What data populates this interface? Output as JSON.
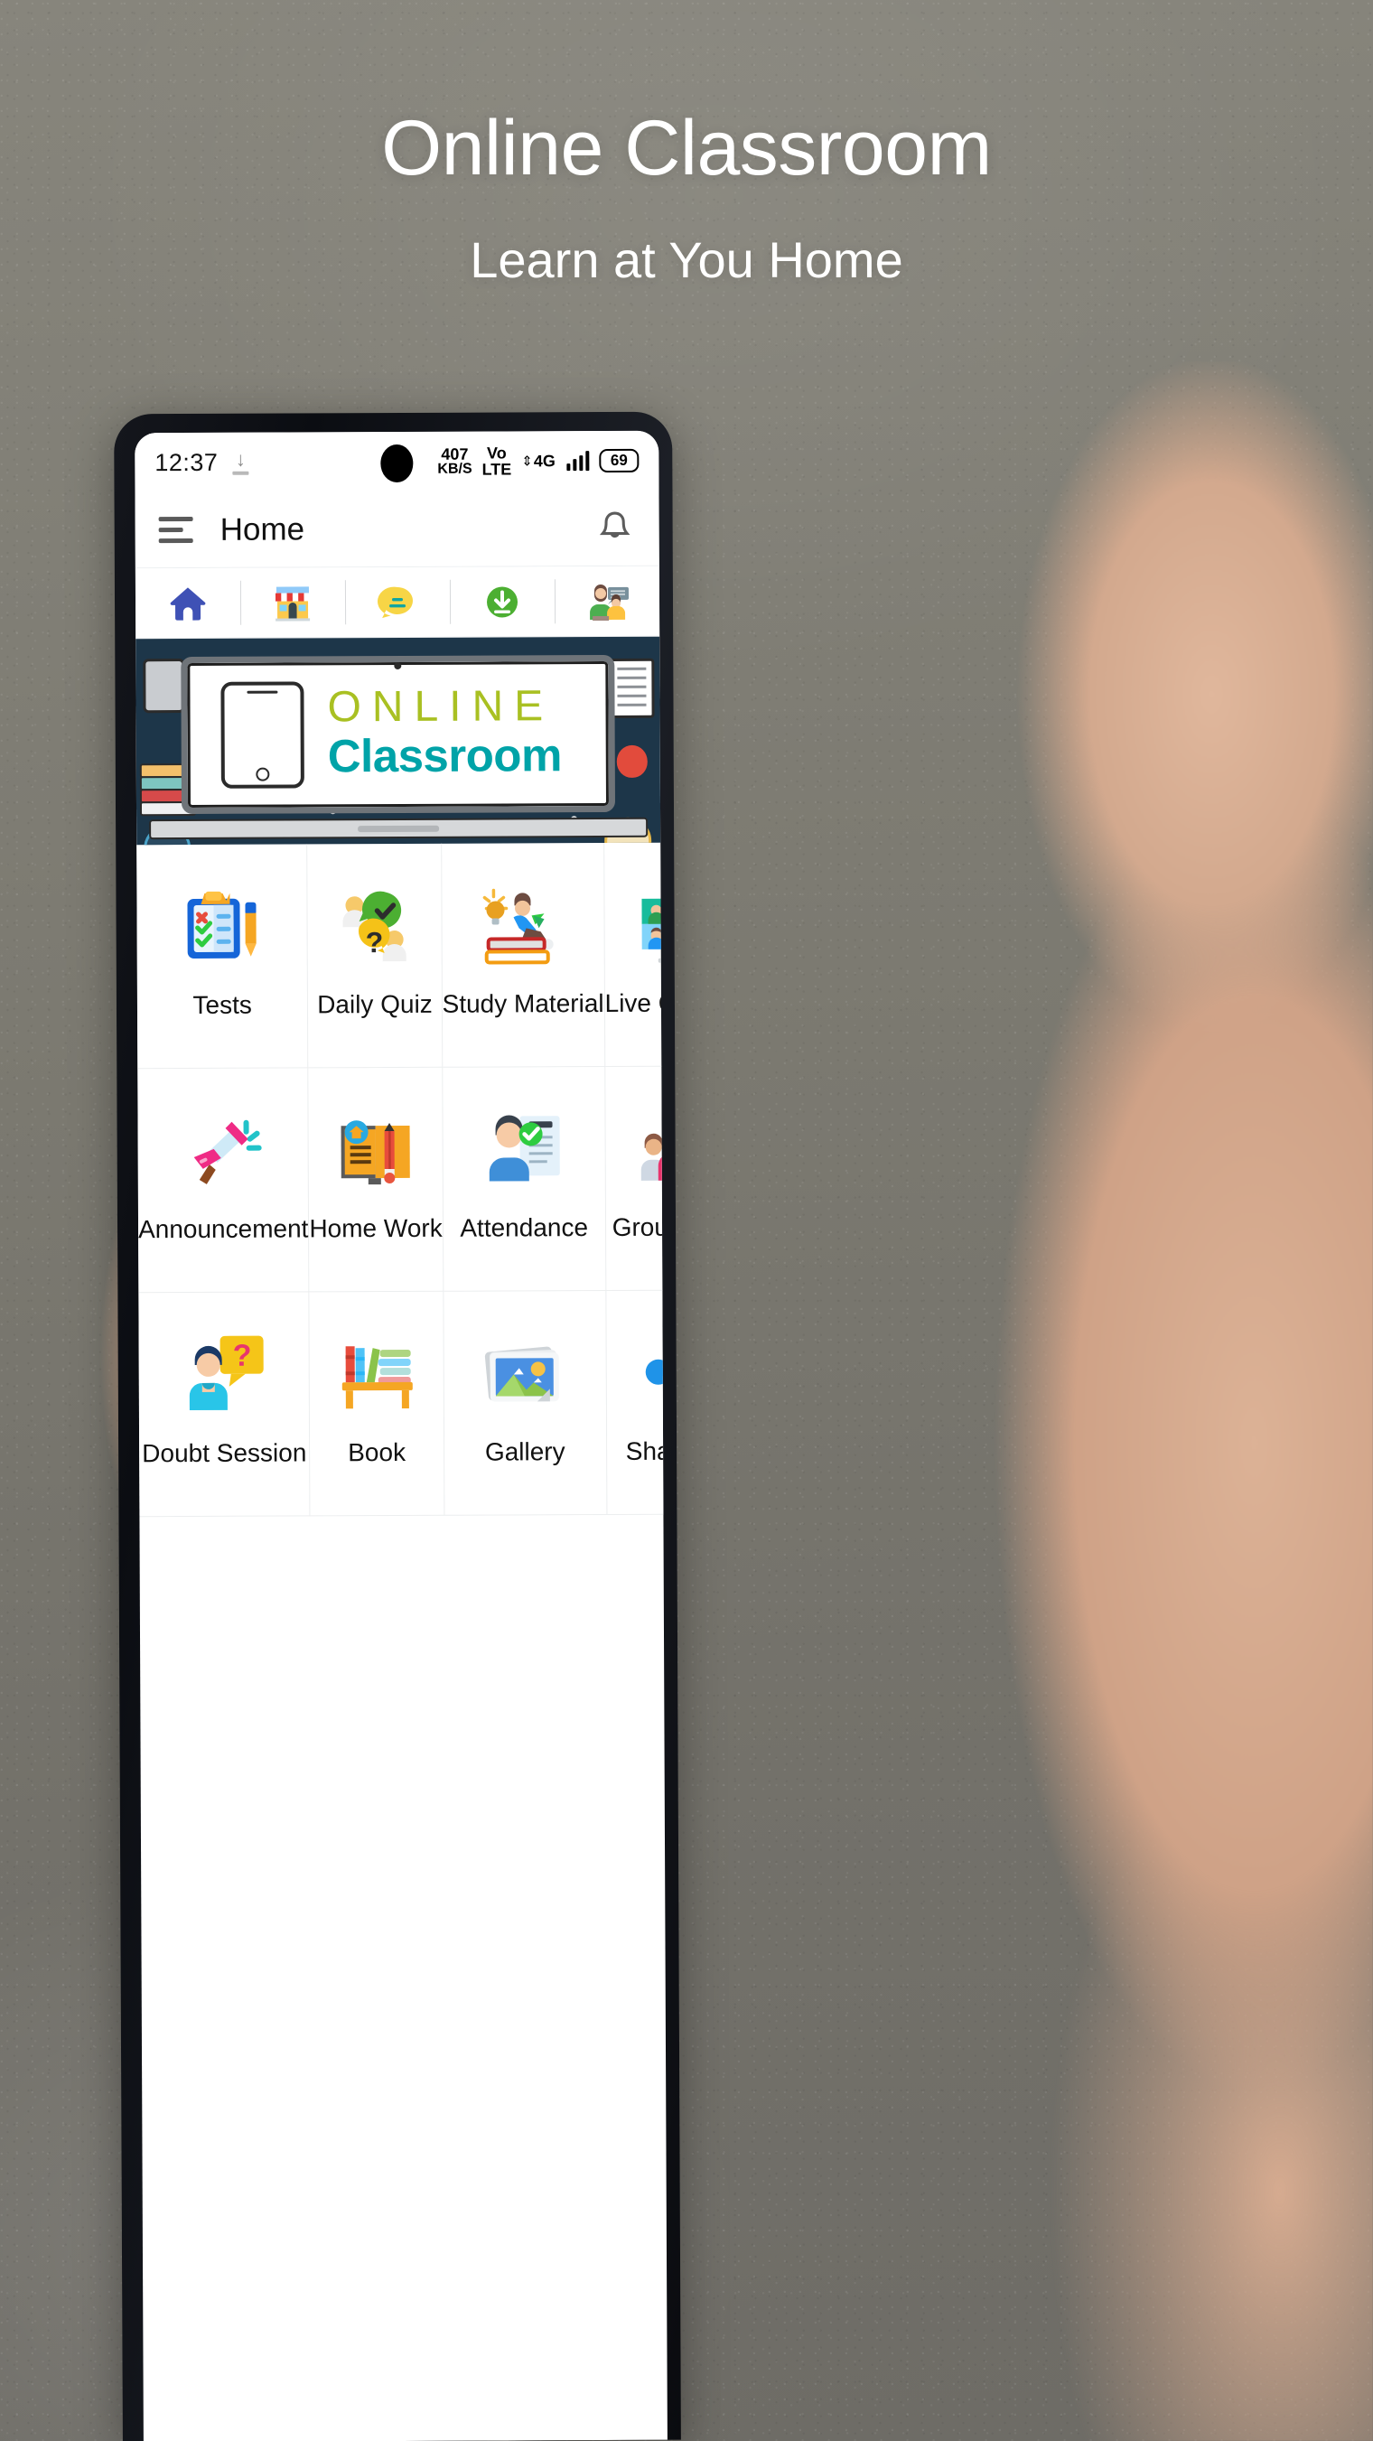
{
  "promo": {
    "title": "Online Classroom",
    "subtitle": "Learn at You Home"
  },
  "status_bar": {
    "time": "12:37",
    "download_icon": "download-arrow-icon",
    "net_speed_value": "407",
    "net_speed_unit": "KB/S",
    "volte_line1": "Vo",
    "volte_line2": "LTE",
    "network_type": "4G",
    "signal_bars": 4,
    "battery": "69"
  },
  "app_bar": {
    "menu_icon": "hamburger-menu-icon",
    "title": "Home",
    "notification_icon": "bell-icon"
  },
  "toolbar": {
    "items": [
      {
        "name": "home",
        "icon": "home-icon"
      },
      {
        "name": "store",
        "icon": "store-icon"
      },
      {
        "name": "chat",
        "icon": "chat-bubble-icon"
      },
      {
        "name": "download",
        "icon": "download-circle-icon"
      },
      {
        "name": "teacher",
        "icon": "teacher-icon"
      }
    ]
  },
  "banner": {
    "brand_line1": "ONLINE",
    "brand_line2": "Classroom",
    "bg_color": "#1d3649",
    "line1_color": "#a9c022",
    "line2_color": "#00a3a8"
  },
  "grid": {
    "items": [
      {
        "label": "Tests",
        "icon": "clipboard-test-icon"
      },
      {
        "label": "Daily Quiz",
        "icon": "quiz-bubbles-icon"
      },
      {
        "label": "Study Material",
        "icon": "books-reader-icon"
      },
      {
        "label": "Live Classes",
        "icon": "video-grid-icon"
      },
      {
        "label": "Announcement",
        "icon": "megaphone-icon"
      },
      {
        "label": "Home Work",
        "icon": "book-pencil-icon"
      },
      {
        "label": "Attendance",
        "icon": "person-checklist-icon"
      },
      {
        "label": "Group Chat",
        "icon": "people-group-icon"
      },
      {
        "label": "Doubt Session",
        "icon": "person-question-icon"
      },
      {
        "label": "Book",
        "icon": "bookshelf-icon"
      },
      {
        "label": "Gallery",
        "icon": "photos-icon"
      },
      {
        "label": "Share Us",
        "icon": "share-nodes-icon"
      }
    ]
  }
}
